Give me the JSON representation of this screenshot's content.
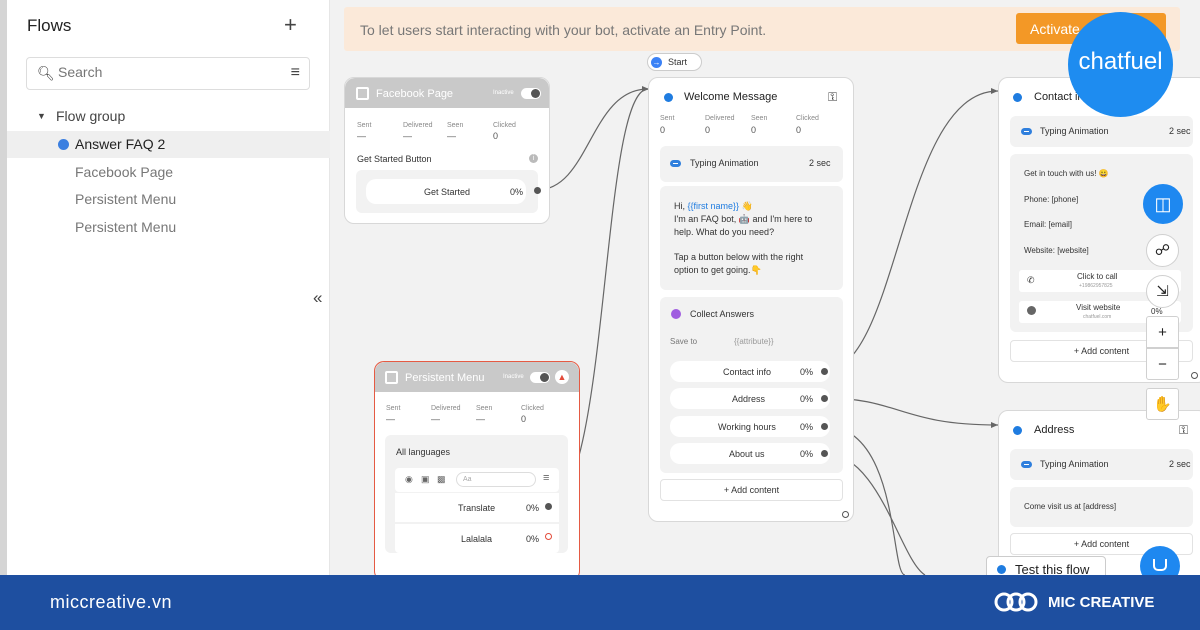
{
  "sidebar": {
    "title": "Flows",
    "add_icon": "+",
    "search_placeholder": "Search",
    "items": [
      {
        "label": "Flow group"
      },
      {
        "label": "Answer FAQ 2"
      },
      {
        "label": "Facebook Page"
      },
      {
        "label": "Persistent Menu"
      },
      {
        "label": "Persistent Menu"
      }
    ],
    "collapse_icon": "«"
  },
  "banner": {
    "text": "To let users start interacting with your bot, activate an Entry Point.",
    "button": "Activate"
  },
  "start_pill": "Start",
  "stats_labels": {
    "sent": "Sent",
    "delivered": "Delivered",
    "seen": "Seen",
    "clicked": "Clicked"
  },
  "facebook_card": {
    "title": "Facebook Page",
    "status": "Inactive",
    "sent": "—",
    "delivered": "—",
    "seen": "—",
    "clicked": "0",
    "section": "Get Started Button",
    "button_label": "Get Started",
    "button_pct": "0%"
  },
  "persistent_card": {
    "title": "Persistent Menu",
    "status": "Inactive",
    "sent": "—",
    "delivered": "—",
    "seen": "—",
    "clicked": "0",
    "section": "All languages",
    "input_placeholder": "Aa",
    "rows": [
      {
        "label": "Translate",
        "pct": "0%"
      },
      {
        "label": "Lalalala",
        "pct": "0%"
      }
    ]
  },
  "welcome_card": {
    "title": "Welcome Message",
    "sent": "0",
    "delivered": "0",
    "seen": "0",
    "clicked": "0",
    "typing_label": "Typing Animation",
    "typing_time": "2 sec",
    "text_line1_prefix": "Hi, ",
    "text_attr": "{{first name}}",
    "text_line1_suffix": " 👋",
    "text_line2": "I'm an FAQ bot, 🤖 and I'm here to",
    "text_line3": "help. What do you need?",
    "text_line4": "Tap a button below with the right",
    "text_line5": "option to get going.👇",
    "collect_label": "Collect Answers",
    "save_to": "Save to",
    "attribute": "{{attribute}}",
    "buttons": [
      {
        "label": "Contact info",
        "pct": "0%"
      },
      {
        "label": "Address",
        "pct": "0%"
      },
      {
        "label": "Working hours",
        "pct": "0%"
      },
      {
        "label": "About us",
        "pct": "0%"
      }
    ],
    "add_content": "+ Add content"
  },
  "contact_card": {
    "title": "Contact in",
    "typing_label": "Typing Animation",
    "typing_time": "2 sec",
    "line1": "Get in touch with us! 😀",
    "line2": "Phone: [phone]",
    "line3": "Email: [email]",
    "line4": "Website: [website]",
    "call_label": "Click to call",
    "call_sub": "+19862957825",
    "visit_label": "Visit website",
    "visit_sub": "chatfuel.com",
    "visit_pct": "0%",
    "add_content": "+ Add content"
  },
  "address_card": {
    "title": "Address",
    "typing_label": "Typing Animation",
    "typing_time": "2 sec",
    "text": "Come visit us at [address]",
    "add_content": "+ Add content"
  },
  "chatfuel_logo": "chatfuel",
  "zoom_in": "+",
  "zoom_out": "−",
  "test_flow": "Test this flow",
  "footer": {
    "site": "miccreative.vn",
    "brand": "MIC CREATIVE"
  },
  "colors": {
    "accent_blue": "#1e88f0",
    "banner_bg": "#fbe9d9",
    "banner_button": "#f39826",
    "footer_bg": "#1e4fa0",
    "alert_red": "#e34b3a"
  }
}
